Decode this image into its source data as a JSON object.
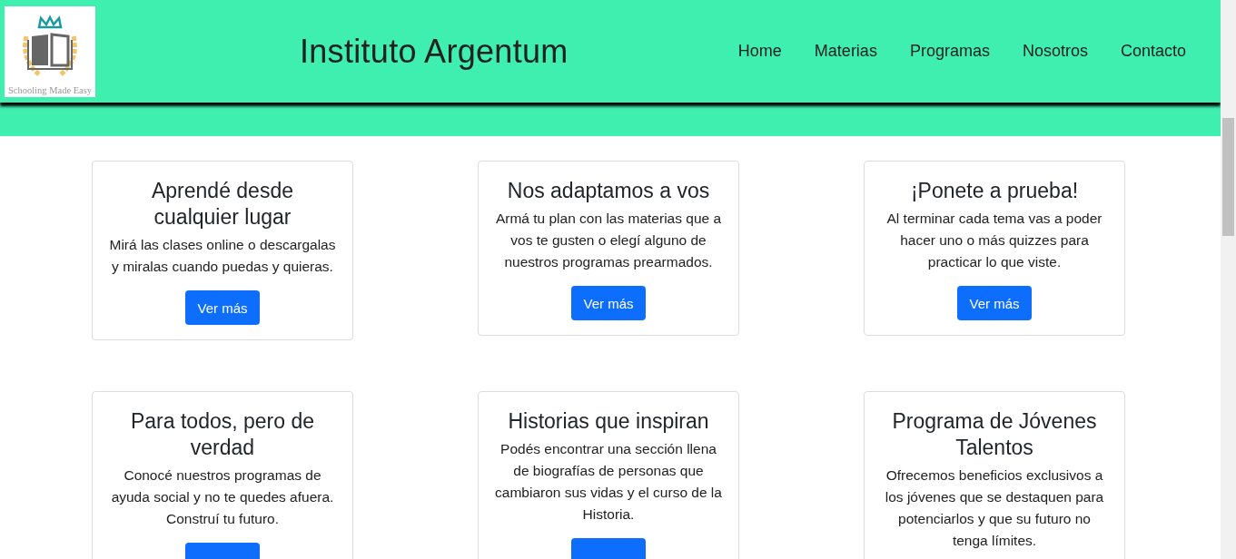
{
  "header": {
    "logo_caption": "Schooling Made Easy",
    "title": "Instituto Argentum",
    "nav": [
      {
        "label": "Home"
      },
      {
        "label": "Materias"
      },
      {
        "label": "Programas"
      },
      {
        "label": "Nosotros"
      },
      {
        "label": "Contacto"
      }
    ]
  },
  "cards": [
    {
      "title": "Aprendé desde cualquier lugar",
      "text": "Mirá las clases online o descargalas y miralas cuando puedas y quieras.",
      "button": "Ver más"
    },
    {
      "title": "Nos adaptamos a vos",
      "text": "Armá tu plan con las materias que a vos te gusten o elegí alguno de nuestros programas prearmados.",
      "button": "Ver más"
    },
    {
      "title": "¡Ponete a prueba!",
      "text": "Al terminar cada tema vas a poder hacer uno o más quizzes para practicar lo que viste.",
      "button": "Ver más"
    },
    {
      "title": "Para todos, pero de verdad",
      "text": "Conocé nuestros programas de ayuda social y no te quedes afuera. Construí tu futuro.",
      "button_top_shown": true
    },
    {
      "title": "Historias que inspiran",
      "text": "Podés encontrar una sección llena de biografías de personas que cambiaron sus vidas y el curso de la Historia.",
      "button_top_shown": true
    },
    {
      "title": "Programa de Jóvenes Talentos",
      "text": "Ofrecemos beneficios exclusivos a los jóvenes que se destaquen para potenciarlos y que su futuro no tenga límites."
    }
  ]
}
